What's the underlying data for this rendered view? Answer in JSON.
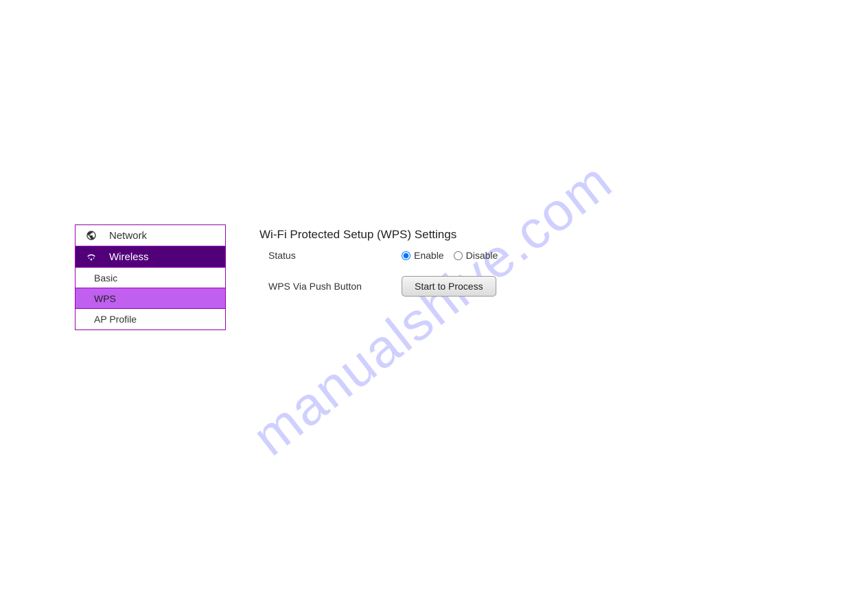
{
  "watermark": "manualshive.com",
  "sidebar": {
    "items": [
      {
        "label": "Network",
        "icon": "globe-icon",
        "active": false
      },
      {
        "label": "Wireless",
        "icon": "wifi-icon",
        "active": true
      }
    ],
    "subitems": [
      {
        "label": "Basic",
        "selected": false
      },
      {
        "label": "WPS",
        "selected": true
      },
      {
        "label": "AP Profile",
        "selected": false
      }
    ]
  },
  "content": {
    "title": "Wi-Fi Protected Setup (WPS) Settings",
    "status": {
      "label": "Status",
      "options": {
        "enable": "Enable",
        "disable": "Disable"
      },
      "selected": "enable"
    },
    "pushButton": {
      "label": "WPS Via Push Button",
      "button": "Start to Process"
    }
  }
}
